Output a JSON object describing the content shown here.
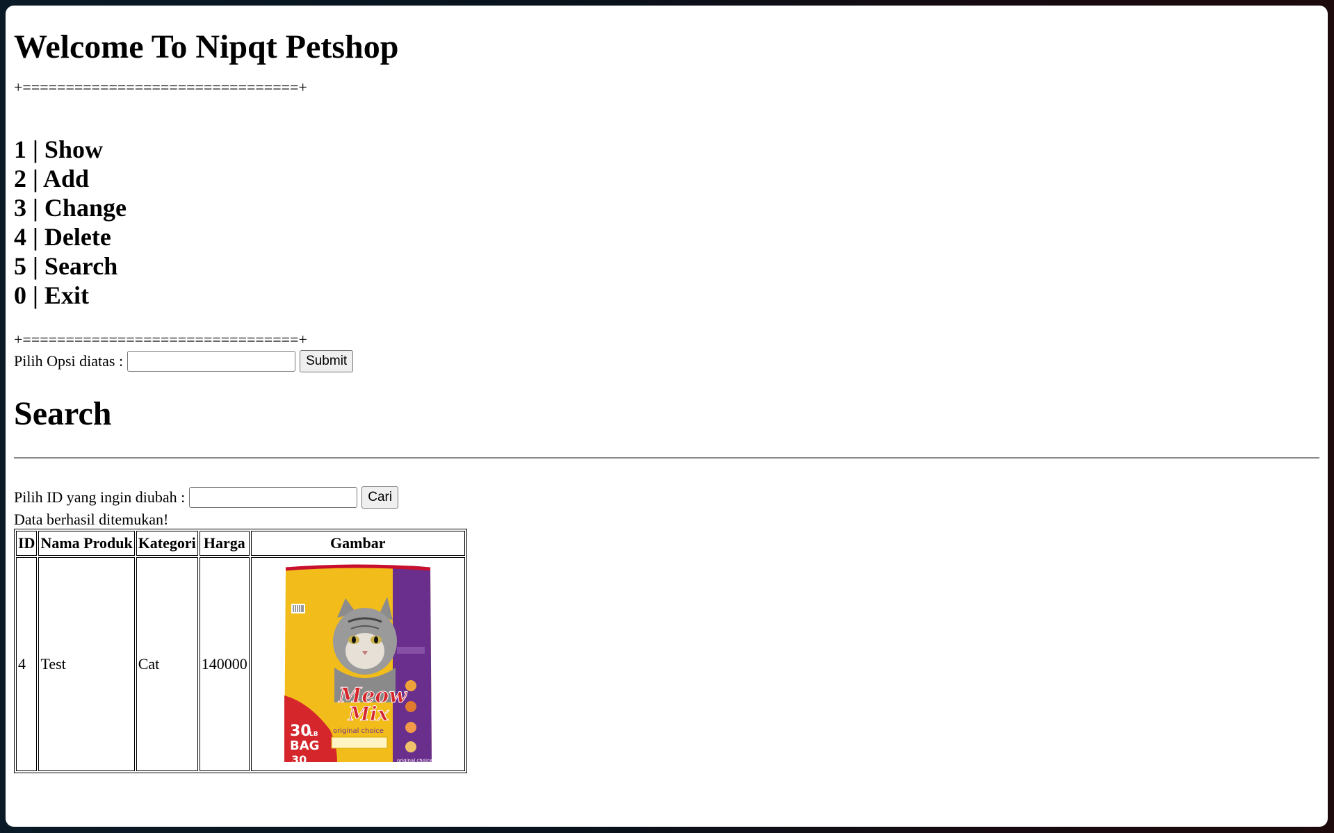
{
  "page": {
    "title": "Welcome To Nipqt Petshop",
    "separator": "+================================+"
  },
  "menu": {
    "items": [
      {
        "label": "1 | Show"
      },
      {
        "label": "2 | Add"
      },
      {
        "label": "3 | Change"
      },
      {
        "label": "4 | Delete"
      },
      {
        "label": "5 | Search"
      },
      {
        "label": "0 | Exit"
      }
    ]
  },
  "option_form": {
    "label": "Pilih Opsi diatas :",
    "value": "",
    "submit_label": "Submit"
  },
  "search": {
    "heading": "Search",
    "label": "Pilih ID yang ingin diubah :",
    "value": "",
    "button_label": "Cari",
    "result_message": "Data berhasil ditemukan!"
  },
  "table": {
    "headers": [
      "ID",
      "Nama Produk",
      "Kategori",
      "Harga",
      "Gambar"
    ],
    "rows": [
      {
        "id": "4",
        "name": "Test",
        "category": "Cat",
        "price": "140000"
      }
    ]
  },
  "product_image": {
    "brand": "Meow Mix",
    "subtitle": "original choice",
    "size": "30 LB BAG",
    "colors": {
      "yellow": "#f2bd1a",
      "purple": "#6a2f8c",
      "red": "#d4262b"
    }
  }
}
